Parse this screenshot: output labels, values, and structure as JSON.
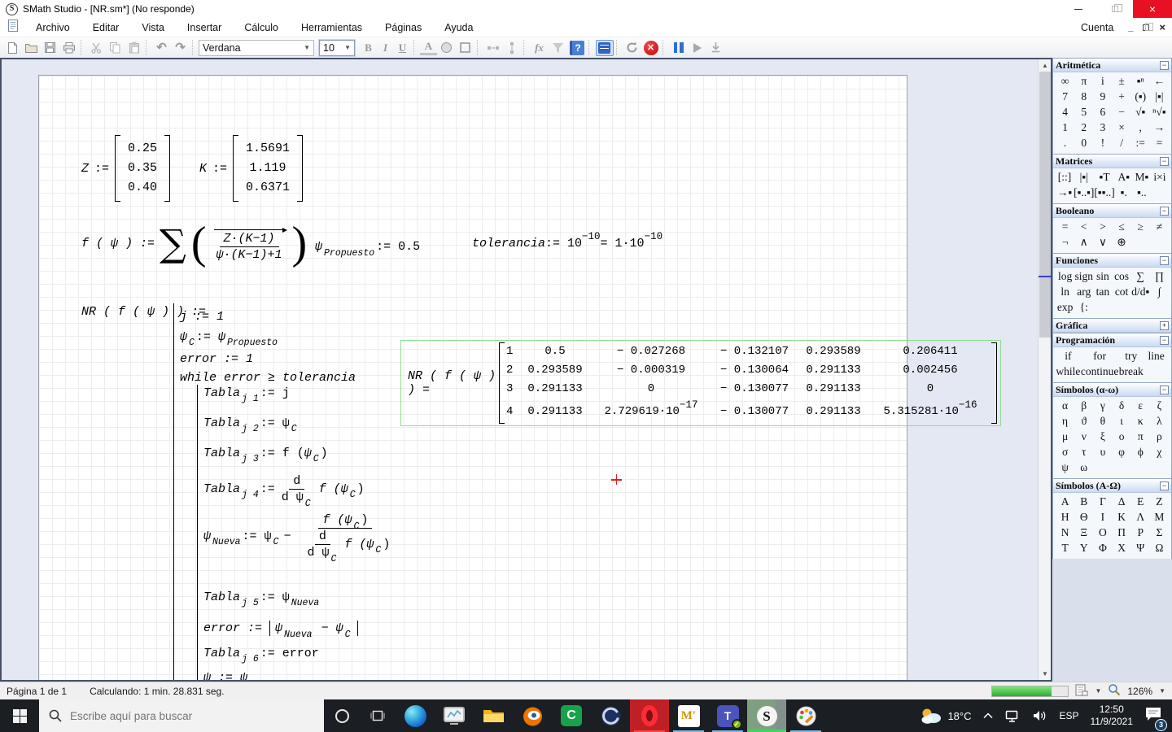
{
  "window": {
    "title": "SMath Studio - [NR.sm*] (No responde)",
    "logo": "S"
  },
  "menu": {
    "items": [
      "Archivo",
      "Editar",
      "Vista",
      "Insertar",
      "Cálculo",
      "Herramientas",
      "Páginas",
      "Ayuda"
    ],
    "account": "Cuenta"
  },
  "toolbar": {
    "font": "Verdana",
    "size": "10",
    "bold": "B",
    "italic": "I",
    "underline": "U",
    "fontcolor": "A",
    "fx": "fx",
    "help": "?",
    "stop": "✕"
  },
  "math": {
    "z": {
      "name": "Z",
      "assign": ":=",
      "values": [
        "0.25",
        "0.35",
        "0.40"
      ]
    },
    "k": {
      "name": "K",
      "assign": ":=",
      "values": [
        "1.5691",
        "1.119",
        "0.6371"
      ]
    },
    "f": {
      "lhs": "f ( ψ ) :=",
      "sigma": "∑",
      "num": "Z·(K−1)",
      "den": "ψ·(K−1)+1"
    },
    "psiProp": {
      "base": "ψ",
      "sub": "Propuesto",
      "rhs": ":= 0.5"
    },
    "tol": {
      "name": "tolerancia",
      "a": ":= 10",
      "e1": "−10",
      "b": "= 1·10",
      "e2": "−10"
    },
    "nr": {
      "label": "NR ( f ( ψ ) ) :=",
      "l1": "j := 1",
      "psi": "ψ",
      "subC": "C",
      "asn": ":=",
      "subProp": "Propuesto",
      "subNueva": "Nueva",
      "l3": "error := 1",
      "l4": "while  error ≥ tolerancia",
      "tabla": "Tabla",
      "j1": "j 1",
      "j2": "j 2",
      "j3": "j 3",
      "j4": "j 4",
      "j5": "j 5",
      "j6": "j 6",
      "r1": ":= j",
      "r2": ":= ψ",
      "r3a": ":= f (",
      "rp": ")",
      "fOpen": "f (",
      "r4a": ":=",
      "d": "d",
      "dpsi": "d ψ",
      "n2": ":= ψ",
      "minus": "−",
      "errAsn": "error :=",
      "absMinus": "− ψ",
      "r6": ":= error",
      "tail": "ψ  := ψ"
    }
  },
  "result": {
    "label": "NR ( f ( ψ ) ) =",
    "rows": [
      [
        "1",
        "0.5",
        "− 0.027268",
        "− 0.132107",
        "0.293589",
        "0.206411"
      ],
      [
        "2",
        "0.293589",
        "− 0.000319",
        "− 0.130064",
        "0.291133",
        "0.002456"
      ],
      [
        "3",
        "0.291133",
        "0",
        "− 0.130077",
        "0.291133",
        "0"
      ],
      [
        "4",
        "0.291133",
        "2.729619·10",
        "− 0.130077",
        "0.291133",
        "5.315281·10"
      ]
    ],
    "exps": {
      "r4c3": "−17",
      "r4c6": "−16"
    }
  },
  "panels": [
    {
      "title": "Aritmética",
      "toggle": "−",
      "cols": 6,
      "buttons": [
        "∞",
        "π",
        "i",
        "±",
        "▪ⁿ",
        "←",
        "7",
        "8",
        "9",
        "+",
        "(▪)",
        "|▪|",
        "4",
        "5",
        "6",
        "−",
        "√▪",
        "ⁿ√▪",
        "1",
        "2",
        "3",
        "×",
        ",",
        "→",
        ".",
        "0",
        "!",
        "/",
        ":=",
        "="
      ]
    },
    {
      "title": "Matrices",
      "toggle": "−",
      "cols": 6,
      "buttons": [
        "[::]",
        "|▪|",
        "▪T",
        "A▪",
        "M▪",
        "i×i",
        "→▪",
        "[▪..▪]",
        "[▪▪..]",
        "▪.",
        "▪.."
      ]
    },
    {
      "title": "Booleano",
      "toggle": "−",
      "cols": 6,
      "buttons": [
        "=",
        "<",
        ">",
        "≤",
        "≥",
        "≠",
        "¬",
        "∧",
        "∨",
        "⊕"
      ]
    },
    {
      "title": "Funciones",
      "toggle": "−",
      "cols": 6,
      "buttons": [
        "log",
        "sign",
        "sin",
        "cos",
        "∑",
        "∏",
        "ln",
        "arg",
        "tan",
        "cot",
        "d/d▪",
        "∫",
        "exp",
        "{:"
      ]
    },
    {
      "title": "Gráfica",
      "toggle": "+",
      "cols": 6,
      "buttons": []
    },
    {
      "title": "Programación",
      "toggle": "−",
      "cols": 4,
      "buttons": [
        "if",
        "for",
        "try",
        "line",
        "while",
        "continue",
        "break"
      ]
    },
    {
      "title": "Símbolos (α-ω)",
      "toggle": "−",
      "cols": 6,
      "buttons": [
        "α",
        "β",
        "γ",
        "δ",
        "ε",
        "ζ",
        "η",
        "ϑ",
        "θ",
        "ι",
        "κ",
        "λ",
        "μ",
        "ν",
        "ξ",
        "ο",
        "π",
        "ρ",
        "σ",
        "τ",
        "υ",
        "φ",
        "ϕ",
        "χ",
        "ψ",
        "ω"
      ]
    },
    {
      "title": "Símbolos (Α-Ω)",
      "toggle": "−",
      "cols": 6,
      "buttons": [
        "Α",
        "Β",
        "Γ",
        "Δ",
        "Ε",
        "Ζ",
        "Η",
        "Θ",
        "Ι",
        "Κ",
        "Λ",
        "Μ",
        "Ν",
        "Ξ",
        "Ο",
        "Π",
        "Ρ",
        "Σ",
        "Τ",
        "Υ",
        "Φ",
        "Χ",
        "Ψ",
        "Ω"
      ]
    }
  ],
  "statusbar": {
    "page": "Página 1 de 1",
    "status": "Calculando: 1 min. 28.831 seg.",
    "zoom": "126%",
    "progress_pct": 78
  },
  "taskbar": {
    "search_placeholder": "Escribe aquí para buscar",
    "apps": [
      "microsoft-edge",
      "task-manager",
      "file-explorer",
      "blender",
      "camtasia",
      "cinema-4d",
      "opera",
      "mathcad",
      "microsoft-teams",
      "smath-studio",
      "paint-3d"
    ],
    "icons": {
      "camtasia": "C",
      "mathcad": "M′",
      "teams": "T",
      "smath": "S"
    },
    "tray": {
      "temperature": "18°C",
      "language": "ESP",
      "time": "12:50",
      "date": "11/9/2021",
      "notification_count": "3"
    }
  }
}
